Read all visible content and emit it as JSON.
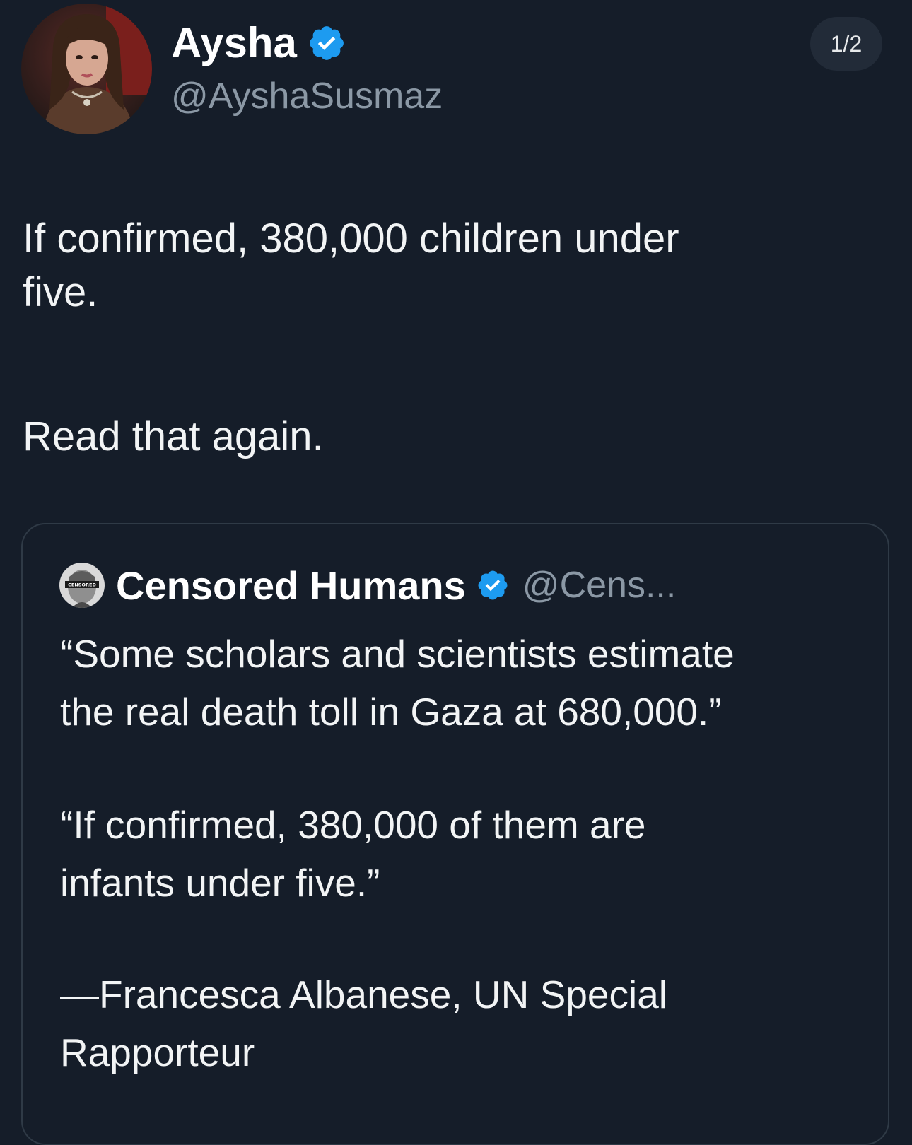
{
  "header": {
    "counter": "1/2"
  },
  "author": {
    "name": "Aysha",
    "handle": "@AyshaSusmaz",
    "verified": true
  },
  "tweet": {
    "lines": [
      "If confirmed, 380,000 children under",
      "five.",
      "Read that again."
    ]
  },
  "quoted": {
    "name": "Censored Humans",
    "handle": "@Cens...",
    "verified": true,
    "avatar_label": "CENSORED",
    "lines": [
      "“Some scholars and scientists estimate",
      "the real death toll in Gaza at 680,000.”",
      "“If confirmed, 380,000 of them are",
      "infants under five.”",
      "—Francesca Albanese, UN Special",
      "Rapporteur"
    ]
  },
  "colors": {
    "background": "#151d29",
    "verified_badge": "#1d9bf0",
    "secondary_text": "#8b98a5",
    "card_border": "#2f3a46"
  },
  "icons": {
    "verified": "verified-badge-icon"
  }
}
